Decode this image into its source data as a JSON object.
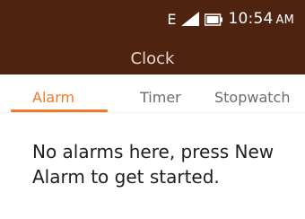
{
  "status_bar": {
    "network": "E",
    "time": "10:54",
    "ampm": "AM",
    "icons": [
      "signal-icon",
      "battery-icon"
    ]
  },
  "app": {
    "title": "Clock"
  },
  "tabs": [
    {
      "label": "Alarm",
      "selected": true
    },
    {
      "label": "Timer",
      "selected": false
    },
    {
      "label": "Stopwatch",
      "selected": false
    }
  ],
  "empty_state": {
    "message": "No alarms here, press New Alarm to get started."
  },
  "colors": {
    "header_bg": "#4e2410",
    "accent": "#f07a2a"
  }
}
